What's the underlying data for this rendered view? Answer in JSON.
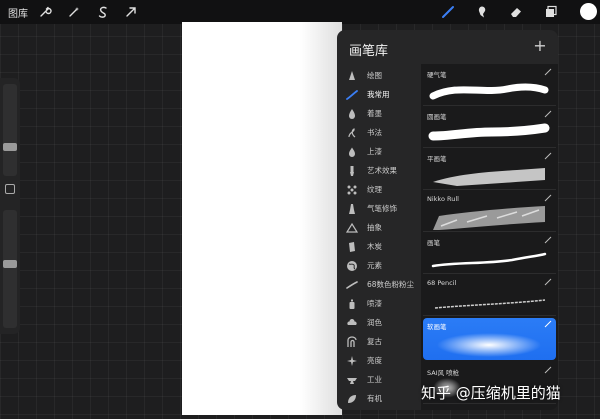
{
  "topbar": {
    "gallery_label": "图库",
    "tools_left": [
      "wrench-icon",
      "magic-wand-icon",
      "selection-s-icon",
      "transform-arrow-icon"
    ],
    "tools_right": [
      "brush-icon",
      "smudge-icon",
      "eraser-icon",
      "layers-icon"
    ],
    "colors": {
      "active_tool": "#3b7ff5",
      "current_color": "#ffffff"
    }
  },
  "sidebar": {
    "size_slider_value": 0.3,
    "opacity_slider_value": 0.55
  },
  "brush_library": {
    "title": "画笔库",
    "add_label": "+",
    "categories": [
      {
        "label": "绘图",
        "icon": "pencil-tip-icon"
      },
      {
        "label": "我常用",
        "icon": "brush-stroke-icon",
        "active": true
      },
      {
        "label": "着墨",
        "icon": "ink-drop-icon"
      },
      {
        "label": "书法",
        "icon": "calligraphy-icon"
      },
      {
        "label": "上漆",
        "icon": "paint-drop-icon"
      },
      {
        "label": "艺术效果",
        "icon": "palette-brush-icon"
      },
      {
        "label": "纹理",
        "icon": "texture-grid-icon"
      },
      {
        "label": "气笔修饰",
        "icon": "airbrush-icon"
      },
      {
        "label": "抽象",
        "icon": "triangle-icon"
      },
      {
        "label": "木炭",
        "icon": "charcoal-icon"
      },
      {
        "label": "元素",
        "icon": "globe-icon"
      },
      {
        "label": "68数色粉粉尘",
        "icon": "spray-stroke-icon"
      },
      {
        "label": "喷漆",
        "icon": "spray-can-icon"
      },
      {
        "label": "润色",
        "icon": "cloud-icon"
      },
      {
        "label": "复古",
        "icon": "retro-icon"
      },
      {
        "label": "亮度",
        "icon": "sparkle-icon"
      },
      {
        "label": "工业",
        "icon": "anvil-icon"
      },
      {
        "label": "有机",
        "icon": "leaf-icon"
      }
    ],
    "brushes": [
      {
        "name": "硬气笔",
        "stroke": "hard"
      },
      {
        "name": "圆画笔",
        "stroke": "round"
      },
      {
        "name": "平画笔",
        "stroke": "flat"
      },
      {
        "name": "Nikko Rull",
        "stroke": "texture"
      },
      {
        "name": "画笔",
        "stroke": "thin"
      },
      {
        "name": "68 Pencil",
        "stroke": "pencil"
      },
      {
        "name": "软画笔",
        "stroke": "soft",
        "selected": true
      },
      {
        "name": "SAI风 喷枪",
        "stroke": "spray"
      }
    ],
    "colors": {
      "selected_bg": "#2b7cf6"
    }
  },
  "watermark": "知乎 @压缩机里的猫"
}
